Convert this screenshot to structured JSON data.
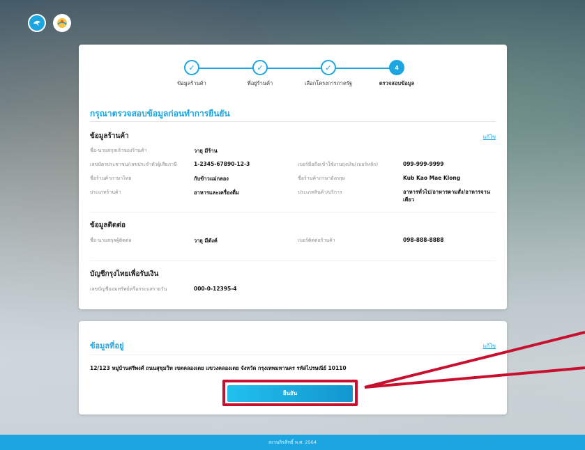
{
  "stepper": {
    "steps": [
      {
        "label": "ข้อมูลร้านค้า",
        "symbol": "✓"
      },
      {
        "label": "ที่อยู่ร้านค้า",
        "symbol": "✓"
      },
      {
        "label": "เลือกโครงการภาครัฐ",
        "symbol": "✓"
      },
      {
        "label": "ตรวจสอบข้อมูล",
        "symbol": "4"
      }
    ]
  },
  "page_title": "กรุณาตรวจสอบข้อมูลก่อนทำการยืนยัน",
  "edit_label": "แก้ไข",
  "shop": {
    "title": "ข้อมูลร้านค้า",
    "owner_name_label": "ชื่อ-นามสกุลเจ้าของร้านค้า",
    "owner_name_value": "วายุ มีร้าน",
    "id_label": "เลขบัตรประชาชน/เลขประจำตัวผู้เสียภาษี",
    "id_value": "1-2345-67890-12-3",
    "phone_label": "เบอร์มือถือเข้าใช้งานถุงเงิน(เบอร์หลัก)",
    "phone_value": "099-999-9999",
    "name_th_label": "ชื่อร้านค้าภาษาไทย",
    "name_th_value": "กับข้าวแม่กลอง",
    "name_en_label": "ชื่อร้านค้าภาษาอังกฤษ",
    "name_en_value": "Kub Kao Mae Klong",
    "type_label": "ประเภทร้านค้า",
    "type_value": "อาหารและเครื่องดื่ม",
    "category_label": "ประเภทสินค้า/บริการ",
    "category_value": "อาหารทั่วไป/อาหารตามสั่ง/อาหารจานเดียว"
  },
  "contact": {
    "title": "ข้อมูลติดต่อ",
    "name_label": "ชื่อ-นามสกุลผู้ติดต่อ",
    "name_value": "วายุ มีตังค์",
    "phone_label": "เบอร์ติดต่อร้านค้า",
    "phone_value": "098-888-8888"
  },
  "bank": {
    "title": "บัญชีกรุงไทยเพื่อรับเงิน",
    "account_label": "เลขบัญชีออมทรัพย์หรือกระแสรายวัน",
    "account_value": "000-0-12395-4"
  },
  "address": {
    "title": "ข้อมูลที่อยู่",
    "text": "12/123 หมู่บ้านศรีพงศ์ ถนนสุขุมวิท เขตคลองเตย แขวงคลองเตย จังหวัด กรุงเทพมหานคร รหัสไปรษณีย์ 10110"
  },
  "confirm_label": "ยืนยัน",
  "footer_text": "สงวนลิขสิทธิ์ พ.ศ. 2564",
  "colors": {
    "accent": "#1ba5e1",
    "highlight": "#c8102e"
  }
}
